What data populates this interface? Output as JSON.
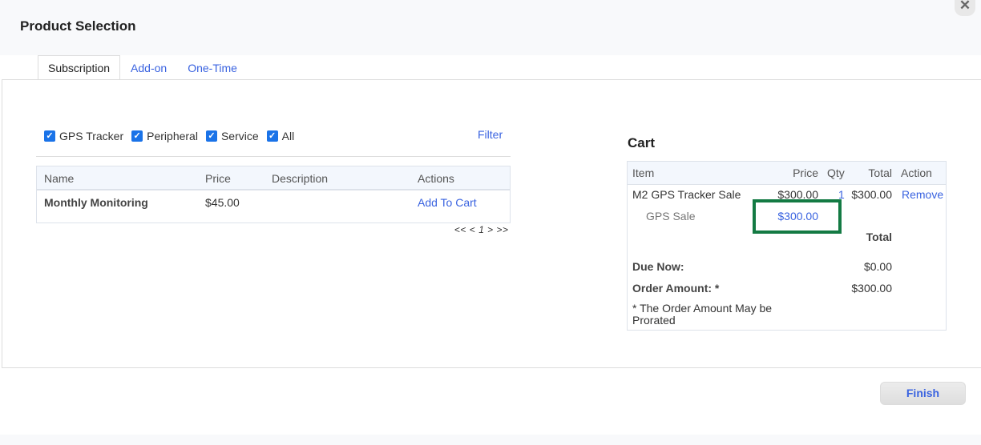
{
  "modal": {
    "title": "Product Selection",
    "close_icon": "close-icon"
  },
  "tabs": [
    {
      "label": "Subscription",
      "active": true
    },
    {
      "label": "Add-on",
      "active": false
    },
    {
      "label": "One-Time",
      "active": false
    }
  ],
  "filters": {
    "items": [
      {
        "label": "GPS Tracker",
        "checked": true
      },
      {
        "label": "Peripheral",
        "checked": true
      },
      {
        "label": "Service",
        "checked": true
      },
      {
        "label": "All",
        "checked": true
      }
    ],
    "filter_link": "Filter"
  },
  "products": {
    "columns": [
      "Name",
      "Price",
      "Description",
      "Actions"
    ],
    "rows": [
      {
        "name": "Monthly Monitoring",
        "price": "$45.00",
        "description": "",
        "action": "Add To Cart"
      }
    ],
    "pager": {
      "first": "<<",
      "prev": "<",
      "page": "1",
      "next": ">",
      "last": ">>"
    }
  },
  "cart": {
    "title": "Cart",
    "columns": [
      "Item",
      "Price",
      "Qty",
      "Total",
      "Action"
    ],
    "items": [
      {
        "item": "M2 GPS Tracker Sale",
        "price": "$300.00",
        "qty": "1",
        "total": "$300.00",
        "action": "Remove",
        "sub": {
          "label": "GPS Sale",
          "price": "$300.00"
        }
      }
    ],
    "total_label": "Total",
    "due_now_label": "Due Now:",
    "due_now_value": "$0.00",
    "order_amount_label": "Order Amount: *",
    "order_amount_value": "$300.00",
    "note": "* The Order Amount May be Prorated",
    "highlight_color": "#137a43"
  },
  "footer": {
    "finish_label": "Finish"
  }
}
